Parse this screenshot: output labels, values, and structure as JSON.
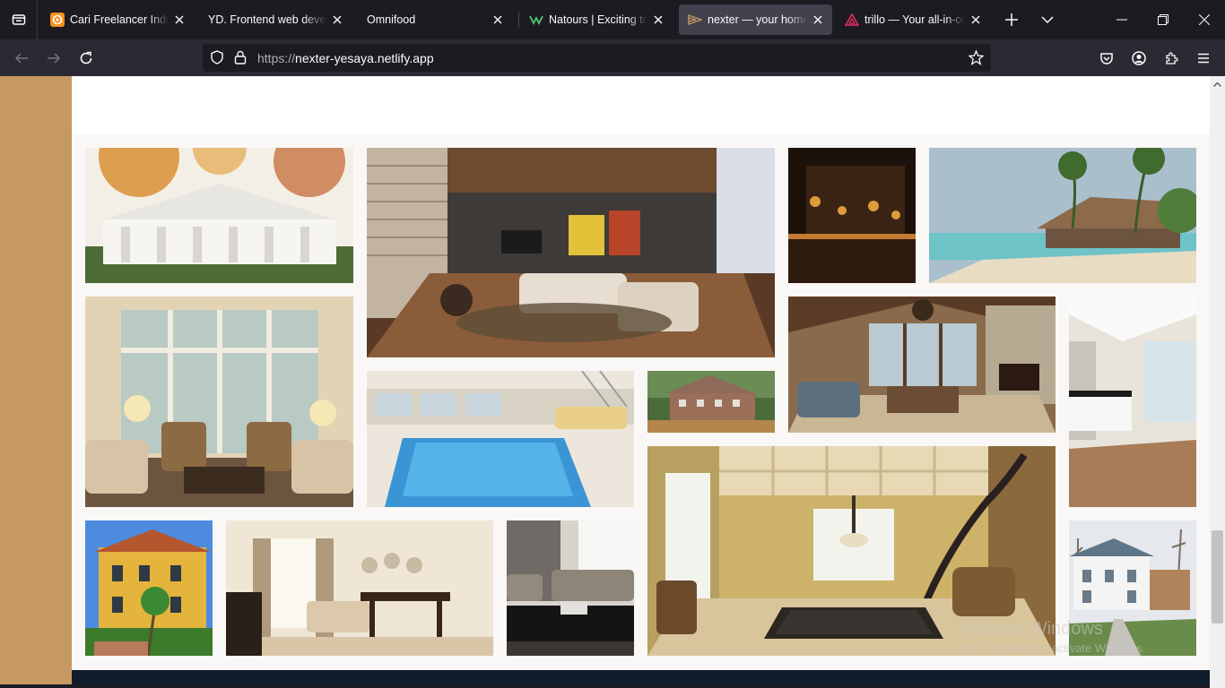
{
  "browser": {
    "tabs": [
      {
        "title": "Cari Freelancer Indonesia",
        "favicon": "orange-chat-icon",
        "active": false
      },
      {
        "title": "YD. Frontend web developer",
        "favicon": "none",
        "active": false
      },
      {
        "title": "Omnifood",
        "favicon": "none",
        "active": false
      },
      {
        "title": "Natours | Exciting tours",
        "favicon": "green-leaf-icon",
        "active": false
      },
      {
        "title": "nexter — your home, your freedom",
        "favicon": "nexter-logo-icon",
        "active": true
      },
      {
        "title": "trillo — Your all-in-one booking app",
        "favicon": "trillo-logo-icon",
        "active": false
      }
    ],
    "url_scheme": "https://",
    "url_host": "nexter-yesaya.netlify.app"
  },
  "colors": {
    "sidebar": "#c69963",
    "footer": "#101d2c",
    "content_bg": "#faf7f7",
    "tabbar_bg": "#1c1b22",
    "navbar_bg": "#2b2a33"
  },
  "gallery": {
    "images": [
      {
        "name": "gallery-image-1",
        "depicts": "white colonial mansion with autumn tree"
      },
      {
        "name": "gallery-image-2",
        "depicts": "modern living room with wooden floor"
      },
      {
        "name": "gallery-image-3",
        "depicts": "dark bar interior with warm lights"
      },
      {
        "name": "gallery-image-4",
        "depicts": "tropical beach resort with palm trees"
      },
      {
        "name": "gallery-image-5",
        "depicts": "sitting room with tall windows"
      },
      {
        "name": "gallery-image-6",
        "depicts": "indoor swimming pool"
      },
      {
        "name": "gallery-image-7",
        "depicts": "wooden house in the countryside"
      },
      {
        "name": "gallery-image-8",
        "depicts": "great room with stone fireplace"
      },
      {
        "name": "gallery-image-9",
        "depicts": "bright modern kitchen"
      },
      {
        "name": "gallery-image-10",
        "depicts": "yellow mediterranean villa"
      },
      {
        "name": "gallery-image-11",
        "depicts": "dining and living area"
      },
      {
        "name": "gallery-image-12",
        "depicts": "dark modern living room"
      },
      {
        "name": "gallery-image-13",
        "depicts": "billiard room with spiral staircase"
      },
      {
        "name": "gallery-image-14",
        "depicts": "white house by a pathway"
      }
    ]
  },
  "watermark": {
    "line1": "Activate Windows",
    "line2": "Go to Settings to activate Windows."
  }
}
